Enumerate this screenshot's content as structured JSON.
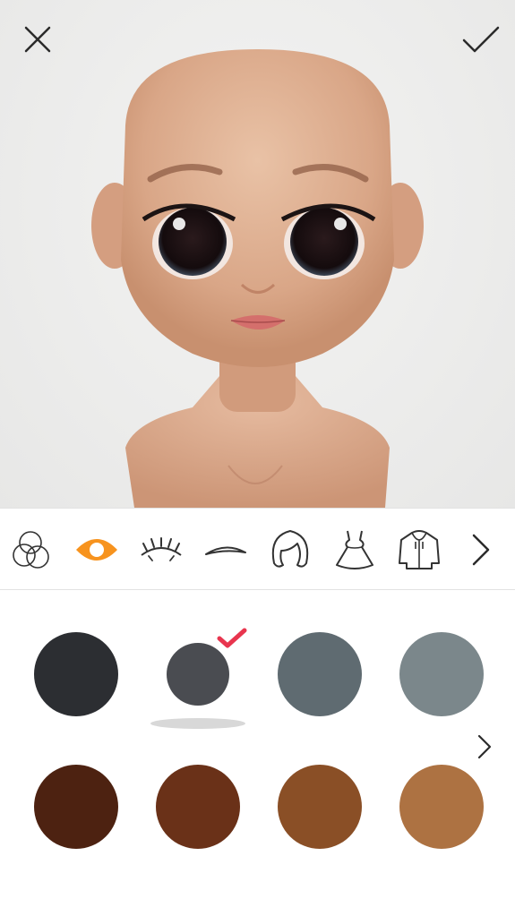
{
  "colors": {
    "accent": "#f7931e",
    "check": "#e8354e",
    "icon_stroke": "#333333"
  },
  "icons": {
    "close": "close-icon",
    "confirm": "checkmark-icon",
    "next_category": "chevron-right-icon",
    "next_palette": "chevron-right-icon"
  },
  "toolbar": {
    "categories": [
      {
        "name": "skin-tone",
        "icon": "overlapping-circles-icon",
        "active": false
      },
      {
        "name": "eyes",
        "icon": "eye-icon",
        "active": true
      },
      {
        "name": "eyelashes",
        "icon": "eyelashes-icon",
        "active": false
      },
      {
        "name": "eyebrows",
        "icon": "eyebrow-icon",
        "active": false
      },
      {
        "name": "hair",
        "icon": "hair-icon",
        "active": false
      },
      {
        "name": "dress",
        "icon": "dress-icon",
        "active": false
      },
      {
        "name": "hoodie",
        "icon": "hoodie-icon",
        "active": false
      }
    ]
  },
  "palette": {
    "selected_index": 1,
    "row1": [
      "#2c2e32",
      "#4a4c51",
      "#5f6b71",
      "#7b878b"
    ],
    "row2": [
      "#4d2211",
      "#6a3118",
      "#8a4f26",
      "#ad7242"
    ]
  }
}
